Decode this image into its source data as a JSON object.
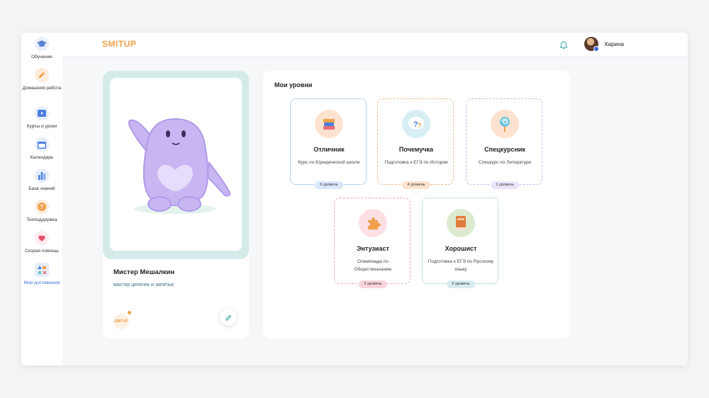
{
  "sidebar": {
    "items": [
      {
        "label": "Обучение",
        "icon": "graduation-cap-icon",
        "color": "#5b7fd6"
      },
      {
        "label": "Домашняя работа",
        "icon": "pencil-icon",
        "color": "#f0a04b"
      },
      {
        "label": "Курсы и уроки",
        "icon": "play-icon",
        "color": "#4a7de0"
      },
      {
        "label": "Календарь",
        "icon": "calendar-icon",
        "color": "#4a7de0"
      },
      {
        "label": "База знаний",
        "icon": "bar-chart-icon",
        "color": "#4a7de0"
      },
      {
        "label": "Техподдержка",
        "icon": "question-icon",
        "color": "#f0a04b"
      },
      {
        "label": "Скорая помощь",
        "icon": "heart-icon",
        "color": "#e84d6b"
      },
      {
        "label": "Мои достижения",
        "icon": "shapes-icon",
        "color": "#4a7de0"
      }
    ]
  },
  "header": {
    "logo": "SMITUP",
    "user_name": "Карина"
  },
  "profile": {
    "name": "Мистер Мешалкин",
    "subtitle": "мастер цепочек и запятых",
    "mini_logo": "SMITUP"
  },
  "levels": {
    "title": "Мои уровни",
    "items": [
      {
        "name": "Отличник",
        "desc": "Курс по Юридической школе",
        "badge": "6 уровень",
        "icon": "books-icon",
        "color": "#6aa0e8"
      },
      {
        "name": "Почемучка",
        "desc": "Подготовка к ЕГЭ по Истории",
        "badge": "4 уровень",
        "icon": "question-bubble-icon",
        "color": "#f0a04b"
      },
      {
        "name": "Спецкурсник",
        "desc": "Спецкурс по Литературе",
        "badge": "1 уровень",
        "icon": "lollipop-icon",
        "color": "#a78be0"
      },
      {
        "name": "Энтузиаст",
        "desc": "Олимпиада по Обществознанию",
        "badge": "2 уровень",
        "icon": "puzzle-icon",
        "color": "#e86b7a"
      },
      {
        "name": "Хорошист",
        "desc": "Подготовка к ЕГЭ по Русскому языку",
        "badge": "5 уровень",
        "icon": "book-icon",
        "color": "#7cc2c8"
      }
    ]
  }
}
